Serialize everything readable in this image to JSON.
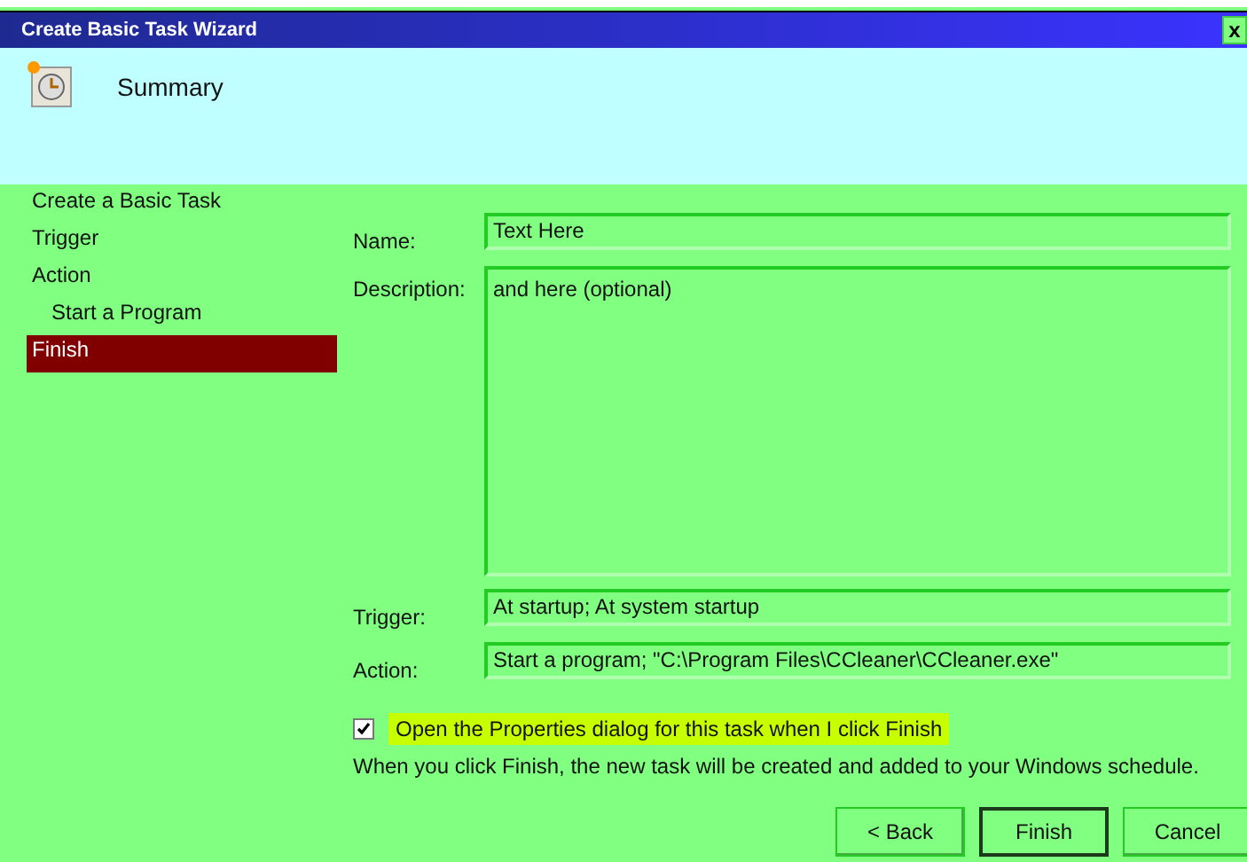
{
  "window": {
    "title": "Create Basic Task Wizard",
    "close": "x"
  },
  "header": {
    "title": "Summary"
  },
  "steps": [
    {
      "label": "Create a Basic Task",
      "selected": false
    },
    {
      "label": "Trigger",
      "selected": false
    },
    {
      "label": "Action",
      "selected": false,
      "children": [
        {
          "label": "Start a Program",
          "selected": false
        }
      ]
    },
    {
      "label": "Finish",
      "selected": true
    }
  ],
  "fields": [
    {
      "label": "Name:",
      "value": "Text Here",
      "kind": "line"
    },
    {
      "label": "Description:",
      "value": "and here (optional)",
      "kind": "area"
    },
    {
      "label": "Trigger:",
      "value": "At startup; At system startup",
      "kind": "line"
    },
    {
      "label": "Action:",
      "value": "Start a program; \"C:\\Program Files\\CCleaner\\CCleaner.exe\"",
      "kind": "line"
    }
  ],
  "open_properties": {
    "label": "Open the Properties dialog for this task when I click Finish",
    "checked": true,
    "highlighted": true
  },
  "note": "When you click Finish, the new task will be created and added to your Windows schedule.",
  "buttons": [
    {
      "label": "< Back",
      "default": false
    },
    {
      "label": "Finish",
      "default": true
    },
    {
      "label": "Cancel",
      "default": false
    }
  ]
}
